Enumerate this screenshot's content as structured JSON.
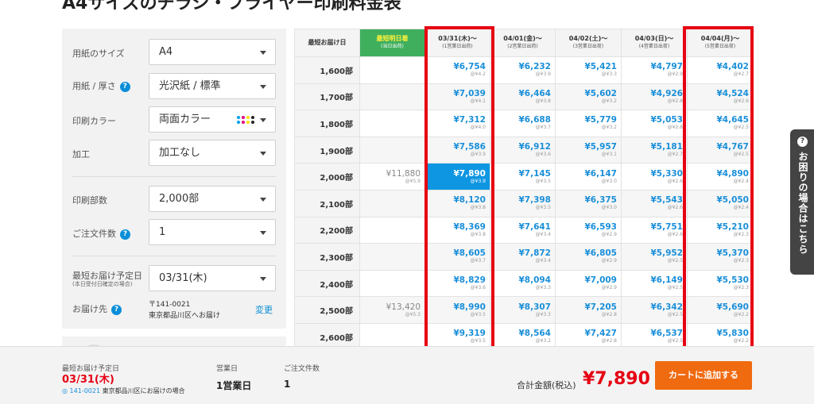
{
  "page": {
    "title": "A4サイズのチラシ・フライヤー印刷料金表"
  },
  "form": {
    "paper_size": {
      "label": "用紙のサイズ",
      "value": "A4"
    },
    "paper_type": {
      "label": "用紙 / 厚さ",
      "value": "光沢紙 / 標準"
    },
    "print_color": {
      "label": "印刷カラー",
      "value": "両面カラー"
    },
    "finishing": {
      "label": "加工",
      "value": "加工なし"
    },
    "quantity": {
      "label": "印刷部数",
      "value": "2,000部"
    },
    "order_count": {
      "label": "ご注文件数",
      "value": "1"
    },
    "delivery_date": {
      "label": "最短お届け予定日",
      "sub_label": "(本日受付日確定の場合)",
      "value": "03/31(木)"
    },
    "destination": {
      "label": "お届け先",
      "zip": "〒141-0021",
      "address": "東京都品川区へお届け",
      "change_link": "変更"
    }
  },
  "table": {
    "corner_header": "最短お届け日",
    "express_header": {
      "title": "最短明日着",
      "sub": "(当日出荷)"
    },
    "date_headers": [
      {
        "title": "03/31(木)〜",
        "sub": "(1営業日出荷)"
      },
      {
        "title": "04/01(金)〜",
        "sub": "(2営業日出荷)"
      },
      {
        "title": "04/02(土)〜",
        "sub": "(3営業日出荷)"
      },
      {
        "title": "04/03(日)〜",
        "sub": "(4営業日出荷)"
      },
      {
        "title": "04/04(月)〜",
        "sub": "(5営業日出荷)"
      }
    ],
    "rows": [
      {
        "qty": "1,600部",
        "express": null,
        "prices": [
          [
            "¥6,754",
            "@¥4.2"
          ],
          [
            "¥6,232",
            "@¥3.9"
          ],
          [
            "¥5,421",
            "@¥3.3"
          ],
          [
            "¥4,797",
            "@¥2.9"
          ],
          [
            "¥4,402",
            "@¥2.7"
          ]
        ]
      },
      {
        "qty": "1,700部",
        "express": null,
        "prices": [
          [
            "¥7,039",
            "@¥4.1"
          ],
          [
            "¥6,464",
            "@¥3.8"
          ],
          [
            "¥5,602",
            "@¥3.2"
          ],
          [
            "¥4,926",
            "@¥2.8"
          ],
          [
            "¥4,524",
            "@¥2.6"
          ]
        ]
      },
      {
        "qty": "1,800部",
        "express": null,
        "prices": [
          [
            "¥7,312",
            "@¥4.0"
          ],
          [
            "¥6,688",
            "@¥3.7"
          ],
          [
            "¥5,779",
            "@¥3.2"
          ],
          [
            "¥5,053",
            "@¥2.8"
          ],
          [
            "¥4,645",
            "@¥2.5"
          ]
        ]
      },
      {
        "qty": "1,900部",
        "express": null,
        "prices": [
          [
            "¥7,586",
            "@¥3.9"
          ],
          [
            "¥6,912",
            "@¥3.6"
          ],
          [
            "¥5,957",
            "@¥3.1"
          ],
          [
            "¥5,181",
            "@¥2.7"
          ],
          [
            "¥4,767",
            "@¥2.5"
          ]
        ]
      },
      {
        "qty": "2,000部",
        "express": [
          "¥11,880",
          "@¥5.9"
        ],
        "selected": 0,
        "prices": [
          [
            "¥7,890",
            "@¥3.9"
          ],
          [
            "¥7,145",
            "@¥3.5"
          ],
          [
            "¥6,147",
            "@¥3.0"
          ],
          [
            "¥5,330",
            "@¥2.6"
          ],
          [
            "¥4,890",
            "@¥2.4"
          ]
        ]
      },
      {
        "qty": "2,100部",
        "express": null,
        "prices": [
          [
            "¥8,120",
            "@¥3.8"
          ],
          [
            "¥7,398",
            "@¥3.5"
          ],
          [
            "¥6,375",
            "@¥3.0"
          ],
          [
            "¥5,543",
            "@¥2.6"
          ],
          [
            "¥5,050",
            "@¥2.4"
          ]
        ]
      },
      {
        "qty": "2,200部",
        "express": null,
        "prices": [
          [
            "¥8,369",
            "@¥3.8"
          ],
          [
            "¥7,641",
            "@¥3.4"
          ],
          [
            "¥6,593",
            "@¥2.9"
          ],
          [
            "¥5,751",
            "@¥2.6"
          ],
          [
            "¥5,210",
            "@¥2.3"
          ]
        ]
      },
      {
        "qty": "2,300部",
        "express": null,
        "prices": [
          [
            "¥8,605",
            "@¥3.7"
          ],
          [
            "¥7,872",
            "@¥3.4"
          ],
          [
            "¥6,805",
            "@¥2.9"
          ],
          [
            "¥5,952",
            "@¥2.5"
          ],
          [
            "¥5,370",
            "@¥2.3"
          ]
        ]
      },
      {
        "qty": "2,400部",
        "express": null,
        "prices": [
          [
            "¥8,829",
            "@¥3.6"
          ],
          [
            "¥8,094",
            "@¥3.3"
          ],
          [
            "¥7,009",
            "@¥2.9"
          ],
          [
            "¥6,149",
            "@¥2.5"
          ],
          [
            "¥5,530",
            "@¥2.3"
          ]
        ]
      },
      {
        "qty": "2,500部",
        "express": [
          "¥13,420",
          "@¥5.3"
        ],
        "prices": [
          [
            "¥8,990",
            "@¥3.5"
          ],
          [
            "¥8,307",
            "@¥3.3"
          ],
          [
            "¥7,205",
            "@¥2.8"
          ],
          [
            "¥6,342",
            "@¥2.5"
          ],
          [
            "¥5,690",
            "@¥2.2"
          ]
        ]
      },
      {
        "qty": "2,600部",
        "express": null,
        "prices": [
          [
            "¥9,319",
            "@¥3.5"
          ],
          [
            "¥8,564",
            "@¥3.2"
          ],
          [
            "¥7,427",
            "@¥2.8"
          ],
          [
            "¥6,537",
            "@¥2.5"
          ],
          [
            "¥5,830",
            "@¥2.2"
          ]
        ]
      }
    ]
  },
  "help_tab": {
    "label": "お困りの場合はこちら"
  },
  "bottom_bar": {
    "delivery_label": "最短お届け予定日",
    "delivery_date": "03/31(木)",
    "zip": "141-0021",
    "address_note": "東京都品川区にお届けの場合",
    "business_day_label": "営業日",
    "business_day_value": "1営業日",
    "order_count_label": "ご注文件数",
    "order_count_value": "1",
    "total_label": "合計金額(税込)",
    "total_value": "¥7,890",
    "cart_button": "カートに追加する"
  },
  "colors": {
    "accent_blue": "#1a8fd9",
    "selected_cell": "#0f96e2",
    "highlight_red": "#e60012",
    "express_green": "#3faf5e",
    "cart_orange": "#f06a10"
  },
  "icons": {
    "help": "help-icon",
    "dropdown": "chevron-down-icon",
    "location": "pin-icon",
    "cmyk": "cmyk-dots-icon"
  }
}
